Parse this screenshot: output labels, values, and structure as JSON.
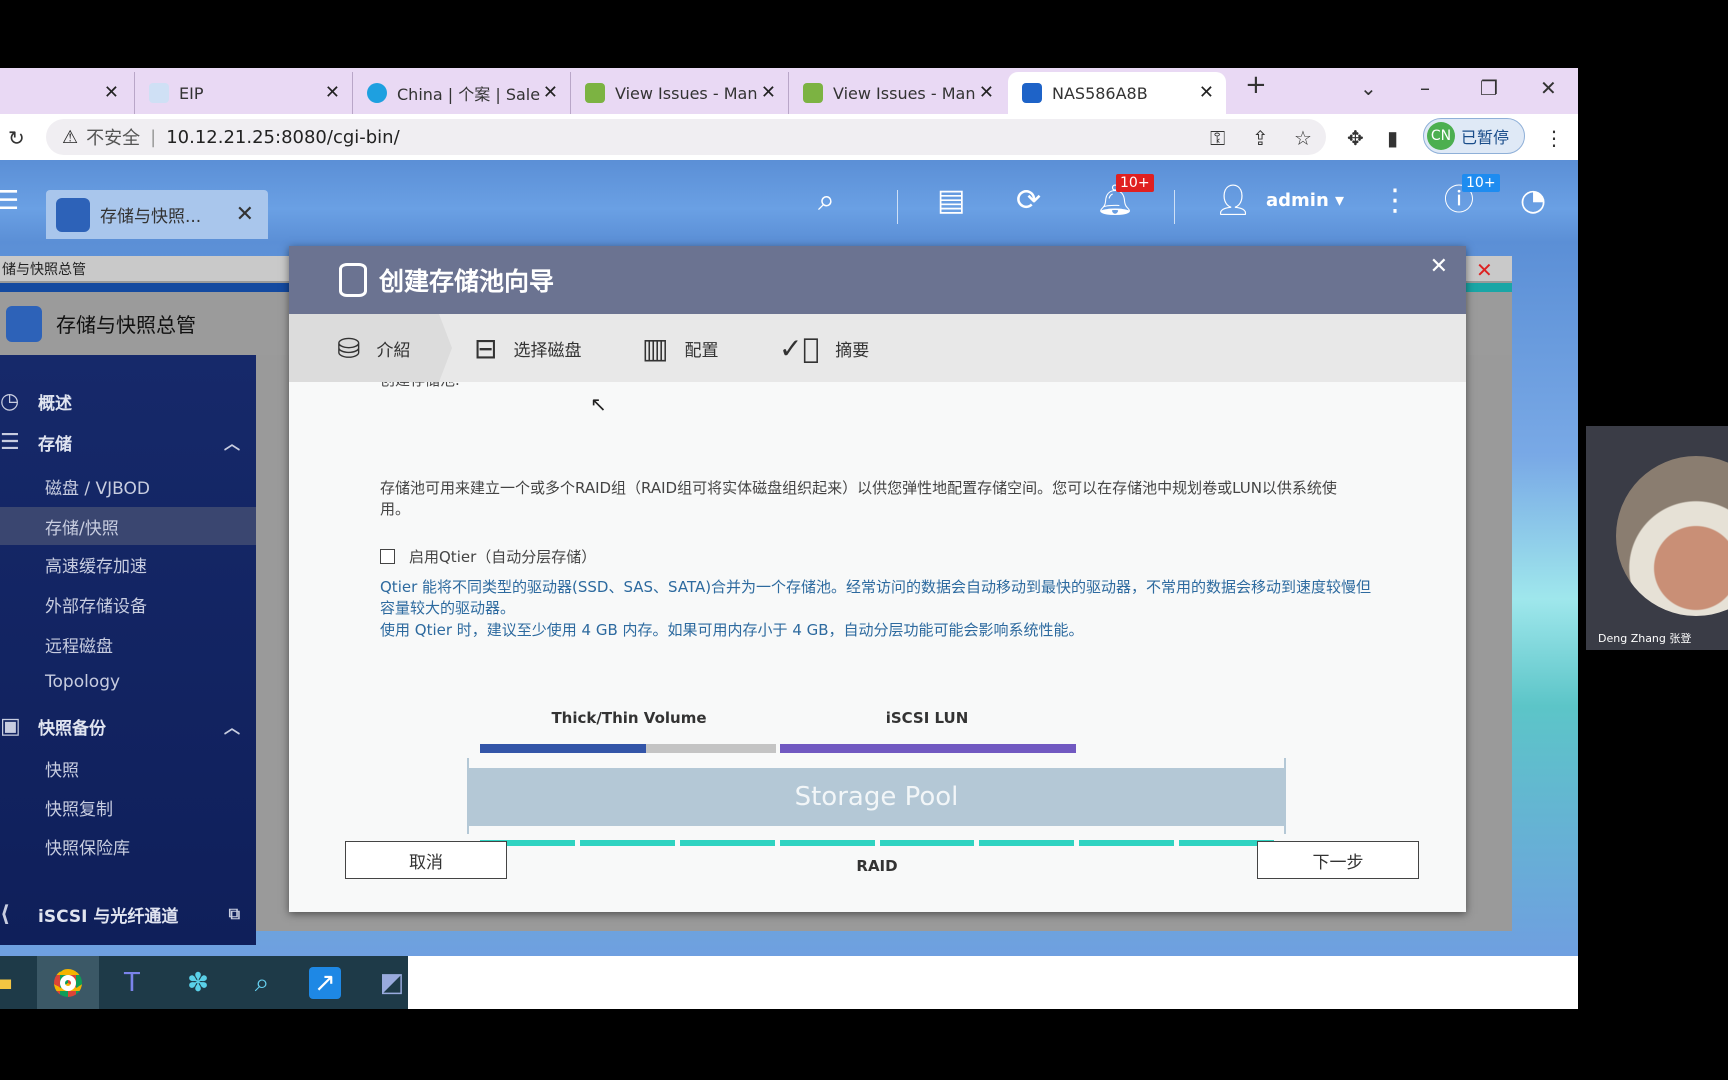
{
  "browser": {
    "tabs": [
      {
        "title": "",
        "icon": "tab-icon"
      },
      {
        "title": "EIP",
        "icon": "ie-icon"
      },
      {
        "title": "China | 个案 | Sale",
        "icon": "salesforce-cloud-icon"
      },
      {
        "title": "View Issues - Man",
        "icon": "mantis-icon"
      },
      {
        "title": "View Issues - Man",
        "icon": "mantis-icon"
      },
      {
        "title": "NAS586A8B",
        "icon": "qnap-icon",
        "active": true
      }
    ],
    "new_tab": "+",
    "security_label": "不安全",
    "url": "10.12.21.25:8080/cgi-bin/",
    "profile_initials": "CN",
    "profile_status": "已暂停"
  },
  "qts": {
    "app_tab": "存储与快照...",
    "user": "admin ▾",
    "notification_badge": "10+",
    "info_badge": "10+"
  },
  "window": {
    "title": "储与快照总管",
    "app_name": "存储与快照总管"
  },
  "sidebar": {
    "items": [
      {
        "label": "概述",
        "level": "top",
        "icon": "dashboard-icon"
      },
      {
        "label": "存储",
        "level": "top",
        "icon": "database-icon",
        "expanded": true
      },
      {
        "label": "磁盘 / VJBOD",
        "level": "sub"
      },
      {
        "label": "存储/快照",
        "level": "sub",
        "selected": true
      },
      {
        "label": "高速缓存加速",
        "level": "sub"
      },
      {
        "label": "外部存储设备",
        "level": "sub"
      },
      {
        "label": "远程磁盘",
        "level": "sub"
      },
      {
        "label": "Topology",
        "level": "sub"
      },
      {
        "label": "快照备份",
        "level": "top",
        "icon": "snapshot-icon",
        "expanded": true
      },
      {
        "label": "快照",
        "level": "sub"
      },
      {
        "label": "快照复制",
        "level": "sub"
      },
      {
        "label": "快照保险库",
        "level": "sub"
      },
      {
        "label": "iSCSI 与光纤通道",
        "level": "top",
        "icon": "iscsi-icon"
      }
    ]
  },
  "dialog": {
    "title": "创建存储池向导",
    "steps": [
      "介紹",
      "选择磁盘",
      "配置",
      "摘要"
    ],
    "cut_text": "创建存储池.",
    "description": "存储池可用来建立一个或多个RAID组（RAID组可将实体磁盘组织起来）以供您弹性地配置存储空间。您可以在存储池中规划卷或LUN以供系统使用。",
    "qtier_checkbox": {
      "label": "启用Qtier（自动分层存储）",
      "checked": false
    },
    "qtier_info": "Qtier 能将不同类型的驱动器(SSD、SAS、SATA)合并为一个存储池。经常访问的数据会自动移动到最快的驱动器，不常用的数据会移动到速度较慢但容量较大的驱动器。",
    "qtier_memory": "使用 Qtier 时，建议至少使用 4 GB 内存。如果可用内存小于 4 GB，自动分层功能可能会影响系统性能。",
    "diagram": {
      "volume_label": "Thick/Thin Volume",
      "lun_label": "iSCSI LUN",
      "pool_label": "Storage Pool",
      "raid_label": "RAID",
      "colors": {
        "volume": "#3355a8",
        "unused": "#c4c4c4",
        "lun": "#7159c1",
        "pool": "#b4c8d6",
        "raid": "#2fd3c1"
      }
    },
    "cancel": "取消",
    "next": "下一步"
  },
  "video": {
    "name": "Deng Zhang 张登"
  }
}
